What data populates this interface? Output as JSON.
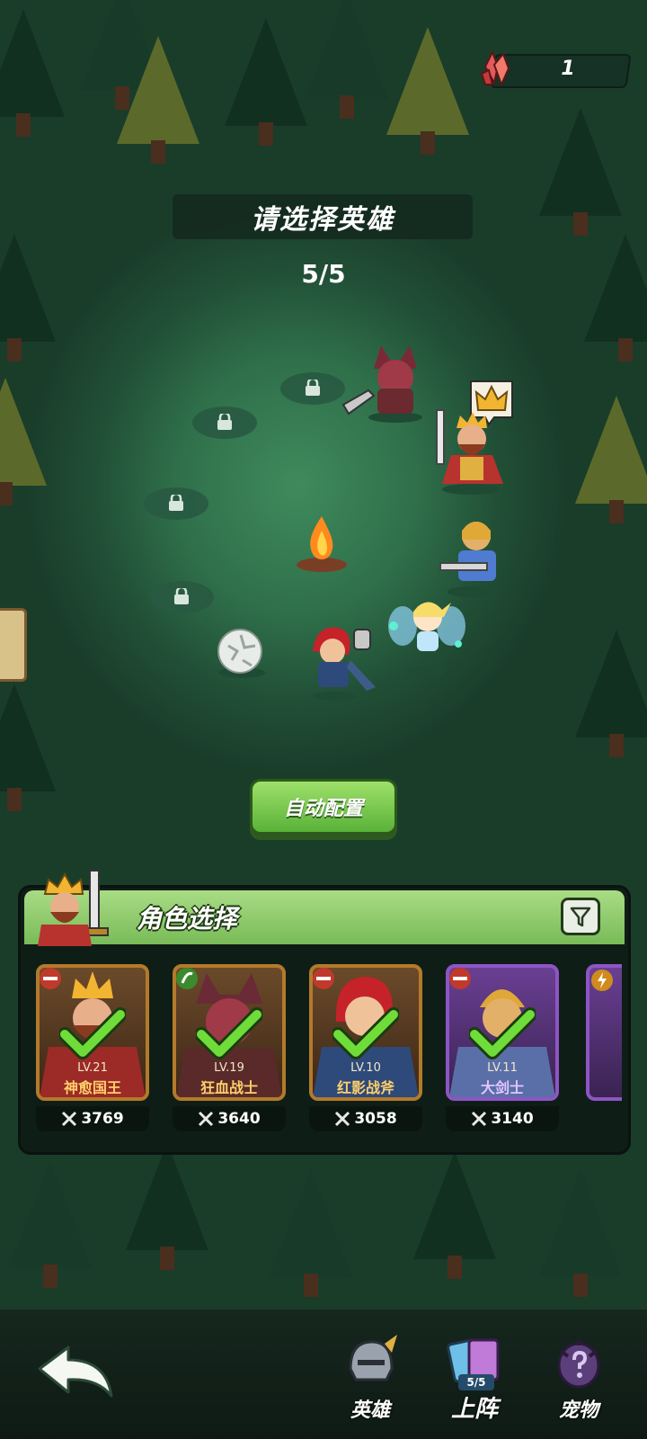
{
  "currency": {
    "value": "1",
    "icon": "crystal-icon"
  },
  "header": {
    "title": "请选择英雄",
    "count": "5/5"
  },
  "slots": [
    {
      "icon": "lock-icon"
    },
    {
      "icon": "lock-icon"
    },
    {
      "icon": "lock-icon"
    },
    {
      "icon": "lock-icon"
    }
  ],
  "leader_badge_icon": "crown-icon",
  "auto_button": {
    "label": "自动配置"
  },
  "panel": {
    "title": "角色选择",
    "filter_icon": "filter-icon",
    "cards": [
      {
        "level": "LV.21",
        "name": "神愈国王",
        "power": "3769",
        "type_icon": "strength-icon",
        "selected": true,
        "rarity": "gold"
      },
      {
        "level": "LV.19",
        "name": "狂血战士",
        "power": "3640",
        "type_icon": "agility-icon",
        "selected": true,
        "rarity": "gold"
      },
      {
        "level": "LV.10",
        "name": "红影战斧",
        "power": "3058",
        "type_icon": "strength-icon",
        "selected": true,
        "rarity": "gold"
      },
      {
        "level": "LV.11",
        "name": "大剑士",
        "power": "3140",
        "type_icon": "strength-icon",
        "selected": true,
        "rarity": "purple"
      }
    ]
  },
  "nav": {
    "back_icon": "back-arrow-icon",
    "items": [
      {
        "label": "英雄",
        "icon": "helmet-icon"
      },
      {
        "label": "上阵",
        "icon": "cards-icon",
        "badge": "5/5"
      },
      {
        "label": "宠物",
        "icon": "pet-egg-icon"
      }
    ]
  },
  "colors": {
    "gold_frame": "#b37a2a",
    "purple_frame": "#8d55c4",
    "accent_green": "#7cc456",
    "name_gold": "#ffcf6a"
  }
}
